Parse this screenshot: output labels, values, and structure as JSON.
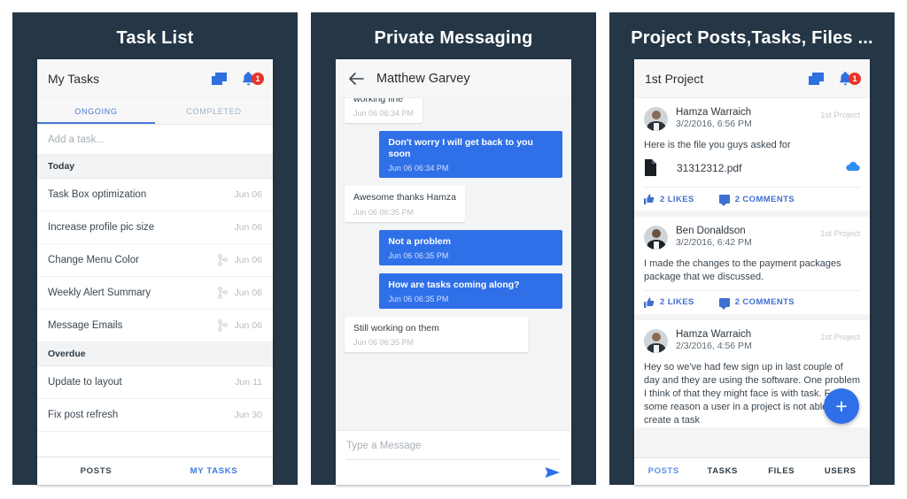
{
  "panels": [
    {
      "title": "Task List",
      "appbar": {
        "title": "My Tasks",
        "chat_icon": "chat-icon",
        "bell_icon": "bell-icon",
        "badge": "1"
      },
      "tabs": [
        {
          "label": "ONGOING",
          "active": true
        },
        {
          "label": "COMPLETED",
          "active": false
        }
      ],
      "add_task_placeholder": "Add a task...",
      "groups": [
        {
          "label": "Today",
          "tasks": [
            {
              "name": "Task Box optimization",
              "date": "Jun 06",
              "branch": false
            },
            {
              "name": "Increase profile pic size",
              "date": "Jun 06",
              "branch": false
            },
            {
              "name": "Change Menu Color",
              "date": "Jun 06",
              "branch": true
            },
            {
              "name": "Weekly Alert Summary",
              "date": "Jun 06",
              "branch": true
            },
            {
              "name": "Message Emails",
              "date": "Jun 06",
              "branch": true
            }
          ]
        },
        {
          "label": "Overdue",
          "tasks": [
            {
              "name": "Update to layout",
              "date": "Jun 11",
              "branch": false
            },
            {
              "name": "Fix post refresh",
              "date": "Jun 30",
              "branch": false
            }
          ]
        }
      ],
      "bottom_nav": [
        {
          "label": "POSTS",
          "active": false
        },
        {
          "label": "MY TASKS",
          "active": true
        }
      ]
    },
    {
      "title": "Private Messaging",
      "appbar": {
        "title": "Matthew Garvey",
        "back_icon": "back-arrow-icon"
      },
      "messages": [
        {
          "text": "working fine",
          "time": "Jun 06 06:34 PM",
          "side": "in",
          "clipped": true
        },
        {
          "text": "Don't worry I will get back to you soon",
          "time": "Jun 06 06:34 PM",
          "side": "out",
          "clipped": false
        },
        {
          "text": "Awesome thanks Hamza",
          "time": "Jun 06 06:35 PM",
          "side": "in",
          "clipped": false
        },
        {
          "text": "Not a problem",
          "time": "Jun 06 06:35 PM",
          "side": "out",
          "clipped": false
        },
        {
          "text": "How are tasks coming along?",
          "time": "Jun 06 06:35 PM",
          "side": "out",
          "clipped": false
        },
        {
          "text": "Still working on them",
          "time": "Jun 06 06:35 PM",
          "side": "in",
          "clipped": false
        }
      ],
      "composer": {
        "placeholder": "Type a Message",
        "send_icon": "send-icon"
      }
    },
    {
      "title": "Project Posts,Tasks, Files ...",
      "appbar": {
        "title": "1st Project",
        "chat_icon": "chat-icon",
        "bell_icon": "bell-icon",
        "badge": "1"
      },
      "posts": [
        {
          "author": "Hamza Warraich",
          "time": "3/2/2016, 6:56 PM",
          "project": "1st Project",
          "text": "Here is the file you guys asked for",
          "avatar_style": "light",
          "file": {
            "name": "31312312.pdf",
            "file_icon": "document-icon",
            "download_icon": "cloud-download-icon"
          },
          "likes": "2 LIKES",
          "comments": "2 COMMENTS"
        },
        {
          "author": "Ben Donaldson",
          "time": "3/2/2016, 6:42 PM",
          "project": "1st Project",
          "text": "I made the changes to the payment packages package that we discussed.",
          "avatar_style": "dark",
          "file": null,
          "likes": "2 LIKES",
          "comments": "2 COMMENTS"
        },
        {
          "author": "Hamza Warraich",
          "time": "2/3/2016, 4:56 PM",
          "project": "1st Project",
          "text": "Hey so we've had few sign up in last couple of day and they are using the software. One problem I think of that they might face is with task. For some reason a user in a project is not able to create a task",
          "avatar_style": "light",
          "file": null,
          "likes": "",
          "comments": ""
        }
      ],
      "fab": {
        "label": "+",
        "icon": "plus-icon",
        "color": "#2f70e8"
      },
      "tabbar": [
        {
          "label": "POSTS",
          "active": true
        },
        {
          "label": "TASKS",
          "active": false
        },
        {
          "label": "FILES",
          "active": false
        },
        {
          "label": "USERS",
          "active": false
        }
      ]
    }
  ],
  "colors": {
    "panel_bg": "#253746",
    "accent_blue": "#2f70e8",
    "link_blue": "#3f6fd0",
    "badge_red": "#e8342a"
  }
}
